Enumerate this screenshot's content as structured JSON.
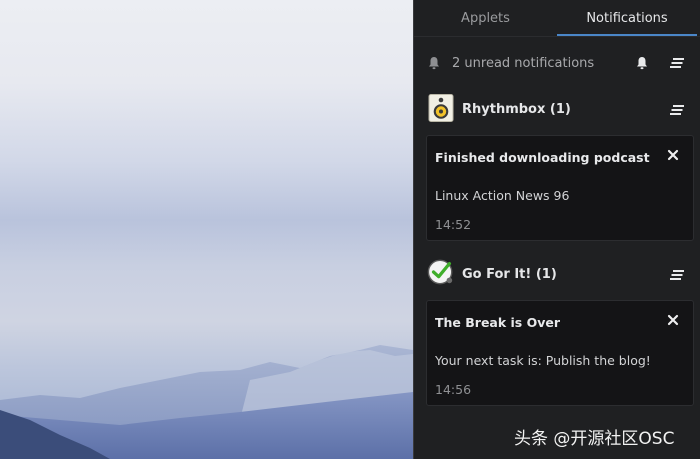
{
  "tabs": {
    "applets": "Applets",
    "notifications": "Notifications"
  },
  "summary": {
    "text": "2 unread notifications"
  },
  "groups": [
    {
      "app": "Rhythmbox (1)",
      "icon": "speaker-icon",
      "card": {
        "title": "Finished downloading podcast",
        "body": "Linux Action News 96",
        "time": "14:52"
      }
    },
    {
      "app": "Go For It! (1)",
      "icon": "checkmark-clock-icon",
      "card": {
        "title": "The Break is Over",
        "body": "Your next task is: Publish the blog!",
        "time": "14:56"
      }
    }
  ],
  "watermark": "头条 @开源社区OSC",
  "colors": {
    "accent": "#4a86c8",
    "panel_bg": "#1f2022",
    "card_bg": "#141416"
  }
}
